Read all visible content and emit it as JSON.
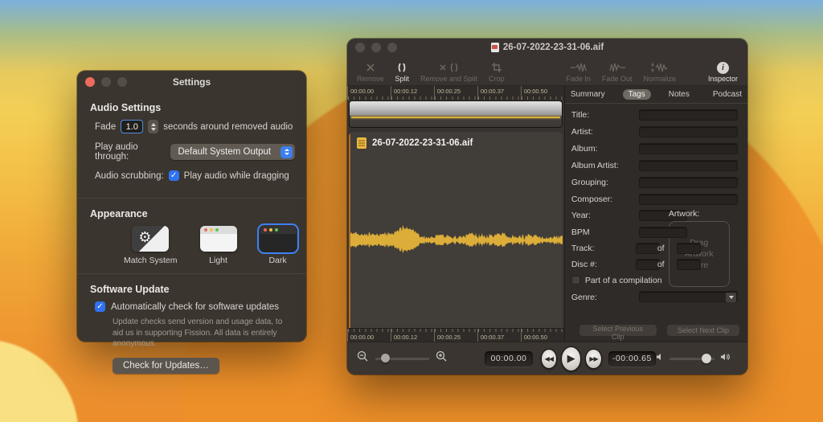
{
  "colors": {
    "accent": "#2f72f2",
    "waveform": "#dcae39",
    "playhead": "#b36a24",
    "selection_ring": "#3b82f7"
  },
  "settings_window": {
    "title": "Settings",
    "audio": {
      "heading": "Audio Settings",
      "fade_label": "Fade",
      "fade_value": "1.0",
      "fade_suffix": "seconds around removed audio",
      "play_label": "Play audio through:",
      "play_value": "Default System Output",
      "scrub_label": "Audio scrubbing:",
      "scrub_option": "Play audio while dragging",
      "scrub_checked": true
    },
    "appearance": {
      "heading": "Appearance",
      "options": [
        {
          "label": "Match System",
          "selected": false
        },
        {
          "label": "Light",
          "selected": false
        },
        {
          "label": "Dark",
          "selected": true
        }
      ]
    },
    "update": {
      "heading": "Software Update",
      "auto_label": "Automatically check for software updates",
      "auto_checked": true,
      "description": "Update checks send version and usage data, to aid us in supporting Fission. All data is entirely anonymous.",
      "button_label": "Check for Updates…"
    }
  },
  "main_window": {
    "title": "26-07-2022-23-31-06.aif",
    "toolbar": {
      "items": [
        {
          "label": "Remove",
          "icon": "remove-icon",
          "disabled": true
        },
        {
          "label": "Split",
          "icon": "split-icon",
          "disabled": false
        },
        {
          "label": "Remove and Split",
          "icon": "remove-and-split-icon",
          "disabled": true
        },
        {
          "label": "Crop",
          "icon": "crop-icon",
          "disabled": true
        },
        {
          "label": "Fade In",
          "icon": "fade-in-icon",
          "disabled": true
        },
        {
          "label": "Fade Out",
          "icon": "fade-out-icon",
          "disabled": true
        },
        {
          "label": "Normalize",
          "icon": "normalize-icon",
          "disabled": true
        },
        {
          "label": "Inspector",
          "icon": "inspector-icon",
          "disabled": false
        }
      ]
    },
    "ruler_ticks": [
      "00:00.00",
      "00:00.12",
      "00:00.25",
      "00:00.37",
      "00:00.50"
    ],
    "clip": {
      "filename": "26-07-2022-23-31-06.aif"
    },
    "transport": {
      "current_time": "00:00.00",
      "remaining_time": "-00:00.65"
    },
    "inspector": {
      "tabs": [
        {
          "label": "Summary",
          "selected": false
        },
        {
          "label": "Tags",
          "selected": true
        },
        {
          "label": "Notes",
          "selected": false
        },
        {
          "label": "Podcast",
          "selected": false
        }
      ],
      "fields": [
        "Title:",
        "Artist:",
        "Album:",
        "Album Artist:",
        "Grouping:",
        "Composer:"
      ],
      "year_label": "Year:",
      "bpm_label": "BPM",
      "track_label": "Track:",
      "disc_label": "Disc #:",
      "of_label": "of",
      "artwork_label": "Artwork:",
      "artwork_placeholder": "Drag Artwork Here",
      "compilation_label": "Part of a compilation",
      "compilation_checked": false,
      "genre_label": "Genre:",
      "prev_button": "Select Previous Clip",
      "next_button": "Select Next Clip"
    }
  }
}
